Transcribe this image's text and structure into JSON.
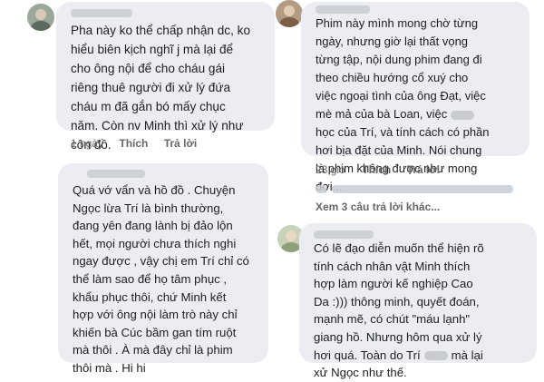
{
  "comments": [
    {
      "lines": [
        "Pha này ko thể chấp nhận dc, ko",
        "hiểu biên kịch nghĩ j mà lại để",
        "cho ông nội để cho cháu gái",
        "riêng thuê người đi xử lý đứa",
        "cháu m đã gắn bó mấy chục",
        "năm. Còn nv Minh thì xử lý như",
        "côn đồ."
      ],
      "time": "1 ngày",
      "like": "Thích",
      "reply": "Trả lời"
    },
    {
      "lines": [
        "Phim này mình mong chờ từng",
        "ngày, nhưng giờ lại thất vọng",
        "từng tập, nội dung phim đang đi",
        "theo chiều hướng cổ xuý cho",
        "việc ngoại tình của ông Đạt, việc",
        "mè mả của bà Loan, việc",
        "học của Trí, và tính cách có phần",
        "hơi bịa đặt của Minh. Nói chung",
        "là phim không được như mong",
        "đợi..."
      ],
      "time": "23 giờ",
      "like": "Thích",
      "reply": "Trả lời",
      "more_replies": "Xem 3 câu trả lời khác..."
    },
    {
      "lines": [
        "Quá vớ vẩn và hồ đồ . Chuyện",
        "Ngọc lừa Trí là bình thường,",
        "đang yên đang lành bị đảo lộn",
        "hết, mọi người chưa thích nghi",
        "ngay được , vậy chị em Trí chỉ có",
        "thể làm sao để họ tâm phục ,",
        "khẩu phục thôi, chứ Minh kết",
        "hợp với ông nội làm trò này chỉ",
        "khiến bà Cúc bầm gan tím ruột",
        "mà thôi . À mà đây chỉ là phim",
        "thôi mà . Hi hi"
      ]
    },
    {
      "lines": [
        "Có lẽ đạo diễn muốn thể hiện rõ",
        "tính cách nhân vật Minh thích",
        "hợp làm người kế nghiệp Cao",
        "Da :))) thông minh, quyết đoán,",
        "mạnh mẽ, có chút \"máu lạnh\"",
        "giang hồ. Nhưng hôm qua xử lý",
        "hơi quá. Toàn do Trí",
        "mà lại",
        "xử Ngọc như thế."
      ]
    }
  ],
  "colors": {
    "bubble": "#ebedf2",
    "meta_text": "#65676b",
    "body_text": "#1c1e21"
  }
}
